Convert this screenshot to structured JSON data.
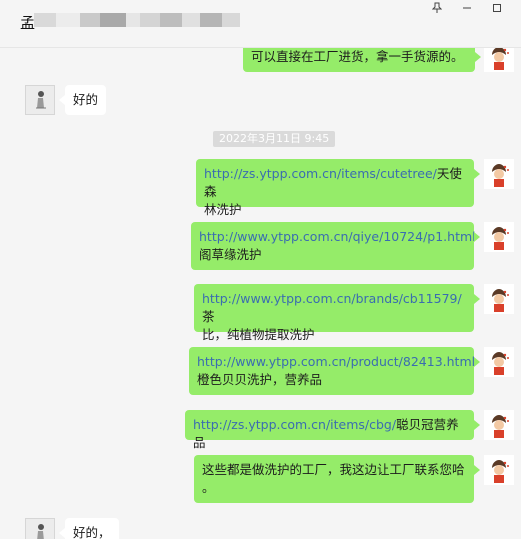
{
  "header": {
    "contact_name": "孟",
    "pin_icon": "pin-icon",
    "minimize_icon": "minimize-icon",
    "maximize_icon": "maximize-icon"
  },
  "messages": {
    "m0": {
      "text": "可以直接在工厂进货，拿一手货源的。"
    },
    "m1": {
      "text": "好的"
    },
    "timestamp": "2022年3月11日 9:45",
    "m2": {
      "link": "http://zs.ytpp.com.cn/items/cutetree/",
      "line1_tail": "天使森",
      "line2": "林洗护"
    },
    "m3": {
      "link": "http://www.ytpp.com.cn/qiye/10724/p1.html",
      "line2": "阁草缘洗护"
    },
    "m4": {
      "link": "http://www.ytpp.com.cn/brands/cb11579/",
      "line1_tail": "茶",
      "line2": "比，纯植物提取洗护"
    },
    "m5": {
      "link": "http://www.ytpp.com.cn/product/82413.html",
      "line2": "橙色贝贝洗护，营养品"
    },
    "m6": {
      "link": "http://zs.ytpp.com.cn/items/cbg/",
      "tail": "聪贝冠营养品"
    },
    "m7": {
      "line1": "这些都是做洗护的工厂，我这边让工厂联系您哈",
      "line2": "。"
    },
    "m8": {
      "text": "好的，"
    }
  },
  "colors": {
    "sent_bubble": "#95ec69",
    "received_bubble": "#ffffff",
    "link": "#3a6db0",
    "background": "#f5f5f5"
  }
}
